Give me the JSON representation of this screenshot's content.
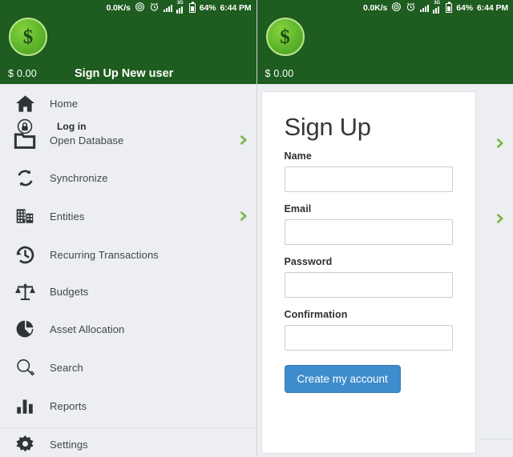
{
  "statusbar": {
    "net_speed": "0.0K/s",
    "wifi_icon": "wifi-icon",
    "alarm_icon": "alarm-clock-icon",
    "signal_icon": "signal-bars-icon",
    "signal_3g_icon": "signal-3g-icon",
    "signal_3g_label": "3G",
    "battery_icon": "battery-icon",
    "battery_percent": "64%",
    "clock": "6:44 PM"
  },
  "header": {
    "avatar_symbol": "$",
    "balance": "$ 0.00",
    "title": "Sign Up New user",
    "bg_color": "#1e5c20",
    "avatar_color": "#5cb32a"
  },
  "menu": {
    "items": [
      {
        "label": "Home",
        "icon": "home-icon",
        "chevron": false,
        "sub": false
      },
      {
        "label": "Log in",
        "icon": "lock-icon",
        "chevron": false,
        "sub": true
      },
      {
        "label": "Open Database",
        "icon": "folder-icon",
        "chevron": true,
        "sub": false
      },
      {
        "label": "Synchronize",
        "icon": "sync-icon",
        "chevron": false,
        "sub": false
      },
      {
        "label": "Entities",
        "icon": "building-icon",
        "chevron": true,
        "sub": false
      },
      {
        "label": "Recurring Transactions",
        "icon": "history-clock-icon",
        "chevron": false,
        "sub": false
      },
      {
        "label": "Budgets",
        "icon": "scales-icon",
        "chevron": false,
        "sub": false
      },
      {
        "label": "Asset Allocation",
        "icon": "pie-chart-icon",
        "chevron": false,
        "sub": false
      },
      {
        "label": "Search",
        "icon": "magnifier-icon",
        "chevron": false,
        "sub": false
      },
      {
        "label": "Reports",
        "icon": "bar-chart-icon",
        "chevron": false,
        "sub": false
      },
      {
        "label": "Settings",
        "icon": "gear-icon",
        "chevron": false,
        "sub": false
      }
    ],
    "chevron_color": "#7ab648",
    "background": "#eceef1"
  },
  "signup": {
    "heading": "Sign Up",
    "fields": [
      {
        "label": "Name",
        "value": "",
        "placeholder": ""
      },
      {
        "label": "Email",
        "value": "",
        "placeholder": ""
      },
      {
        "label": "Password",
        "value": "",
        "placeholder": ""
      },
      {
        "label": "Confirmation",
        "value": "",
        "placeholder": ""
      }
    ],
    "submit_label": "Create my account",
    "submit_color": "#3f8ccd"
  }
}
